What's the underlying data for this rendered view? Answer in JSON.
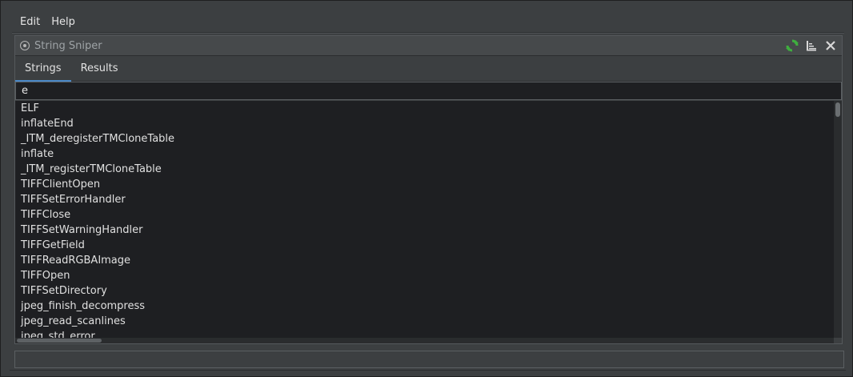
{
  "menubar": {
    "items": [
      {
        "label": "Edit"
      },
      {
        "label": "Help"
      }
    ]
  },
  "dock": {
    "title": "String Sniper",
    "icons": {
      "refresh": "refresh-icon",
      "sort": "sort-icon",
      "close": "close-icon"
    },
    "accent": "#4a88c7",
    "refresh_color": "#3fae3f"
  },
  "tabs": [
    {
      "label": "Strings",
      "active": true
    },
    {
      "label": "Results",
      "active": false
    }
  ],
  "search": {
    "value": "e"
  },
  "strings": [
    "ELF",
    "inflateEnd",
    "_ITM_deregisterTMCloneTable",
    "inflate",
    "_ITM_registerTMCloneTable",
    "TIFFClientOpen",
    "TIFFSetErrorHandler",
    "TIFFClose",
    "TIFFSetWarningHandler",
    "TIFFGetField",
    "TIFFReadRGBAImage",
    "TIFFOpen",
    "TIFFSetDirectory",
    "jpeg_finish_decompress",
    "jpeg_read_scanlines",
    "jpeg_std_error"
  ],
  "statusbar": {
    "text": ""
  }
}
